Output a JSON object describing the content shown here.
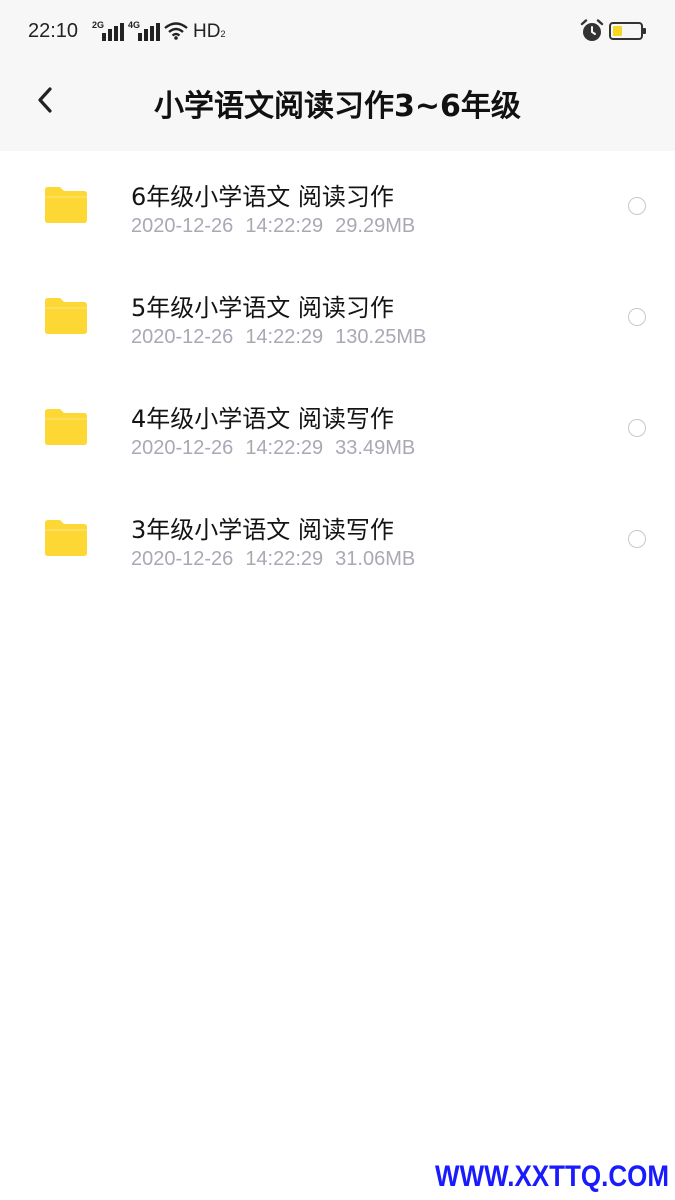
{
  "status_bar": {
    "time": "22:10",
    "signal_1_label": "2G",
    "signal_2_label": "4G",
    "network_label": "HD",
    "network_sub": "2",
    "battery_color": "#f6d623"
  },
  "header": {
    "back_icon": "chevron-left-icon",
    "title": "小学语文阅读习作3~6年级"
  },
  "files": [
    {
      "name": "6年级小学语文 阅读习作",
      "date": "2020-12-26",
      "time": "14:22:29",
      "size": "29.29MB",
      "icon": "folder-icon"
    },
    {
      "name": "5年级小学语文 阅读习作",
      "date": "2020-12-26",
      "time": "14:22:29",
      "size": "130.25MB",
      "icon": "folder-icon"
    },
    {
      "name": "4年级小学语文 阅读写作",
      "date": "2020-12-26",
      "time": "14:22:29",
      "size": "33.49MB",
      "icon": "folder-icon"
    },
    {
      "name": "3年级小学语文 阅读写作",
      "date": "2020-12-26",
      "time": "14:22:29",
      "size": "31.06MB",
      "icon": "folder-icon"
    }
  ],
  "colors": {
    "folder": "#fdd835",
    "header_bg": "#f7f7f7",
    "meta_text": "#a9a9b4"
  },
  "watermark": "WWW.XXTTQ.COM"
}
